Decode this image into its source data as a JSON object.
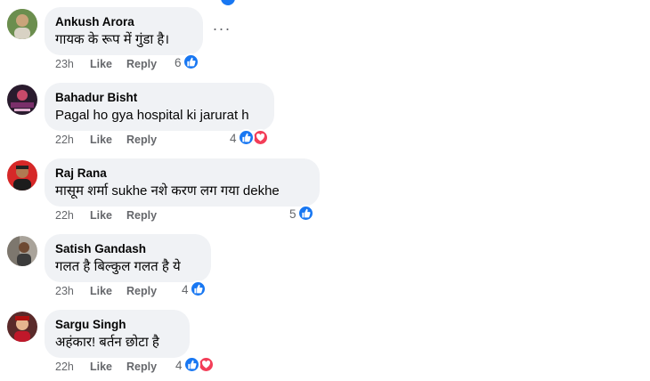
{
  "actions": {
    "like": "Like",
    "reply": "Reply"
  },
  "colors": {
    "like_blue": "#1877f2",
    "love_red": "#f33e58",
    "bubble_bg": "#f0f2f5",
    "meta_gray": "#65676b"
  },
  "comments": [
    {
      "author": "Ankush Arora",
      "text": "गायक के रूप में गुंडा है।",
      "time": "23h",
      "reaction_count": "6",
      "reactions": [
        "like-icon"
      ],
      "more_menu": "···"
    },
    {
      "author": "Bahadur Bisht",
      "text": "Pagal ho gya hospital ki jarurat h",
      "time": "22h",
      "reaction_count": "4",
      "reactions": [
        "like-icon",
        "love-icon"
      ]
    },
    {
      "author": "Raj Rana",
      "text": "मासूम शर्मा sukhe नशे करण लग गया dekhe",
      "time": "22h",
      "reaction_count": "5",
      "reactions": [
        "like-icon"
      ]
    },
    {
      "author": "Satish Gandash",
      "text": "गलत है बिल्कुल गलत है ये",
      "time": "23h",
      "reaction_count": "4",
      "reactions": [
        "like-icon"
      ]
    },
    {
      "author": "Sargu Singh",
      "text": "अहंकार! बर्तन छोटा है",
      "time": "22h",
      "reaction_count": "4",
      "reactions": [
        "like-icon",
        "love-icon"
      ]
    }
  ]
}
